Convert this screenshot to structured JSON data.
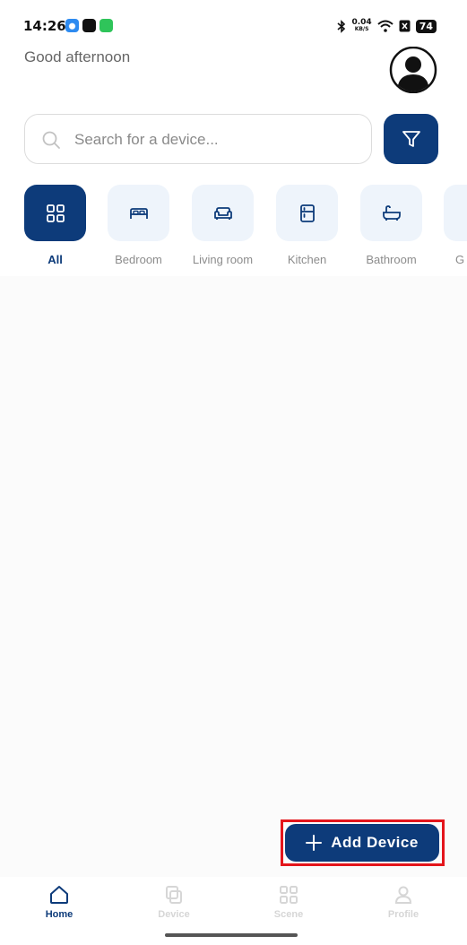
{
  "status_bar": {
    "time": "14:26",
    "net_speed_value": "0.04",
    "net_speed_unit": "KB/S",
    "battery": "74"
  },
  "header": {
    "greeting": "Good afternoon",
    "avatar_icon": "user-avatar-icon"
  },
  "search": {
    "placeholder": "Search for a device...",
    "icon": "search-icon",
    "filter_icon": "filter-icon"
  },
  "categories": [
    {
      "label": "All",
      "icon": "grid-icon",
      "active": true
    },
    {
      "label": "Bedroom",
      "icon": "bed-icon",
      "active": false
    },
    {
      "label": "Living room",
      "icon": "sofa-icon",
      "active": false
    },
    {
      "label": "Kitchen",
      "icon": "fridge-icon",
      "active": false
    },
    {
      "label": "Bathroom",
      "icon": "bathtub-icon",
      "active": false
    },
    {
      "label": "G",
      "icon": "category-icon",
      "active": false
    }
  ],
  "actions": {
    "add_device_label": "Add Device"
  },
  "bottom_nav": [
    {
      "label": "Home",
      "icon": "home-icon",
      "active": true
    },
    {
      "label": "Device",
      "icon": "device-icon",
      "active": false
    },
    {
      "label": "Scene",
      "icon": "scene-icon",
      "active": false
    },
    {
      "label": "Profile",
      "icon": "profile-icon",
      "active": false
    }
  ],
  "colors": {
    "primary": "#0d3b7a",
    "tile_bg": "#eef4fb",
    "highlight": "#e4151b"
  }
}
